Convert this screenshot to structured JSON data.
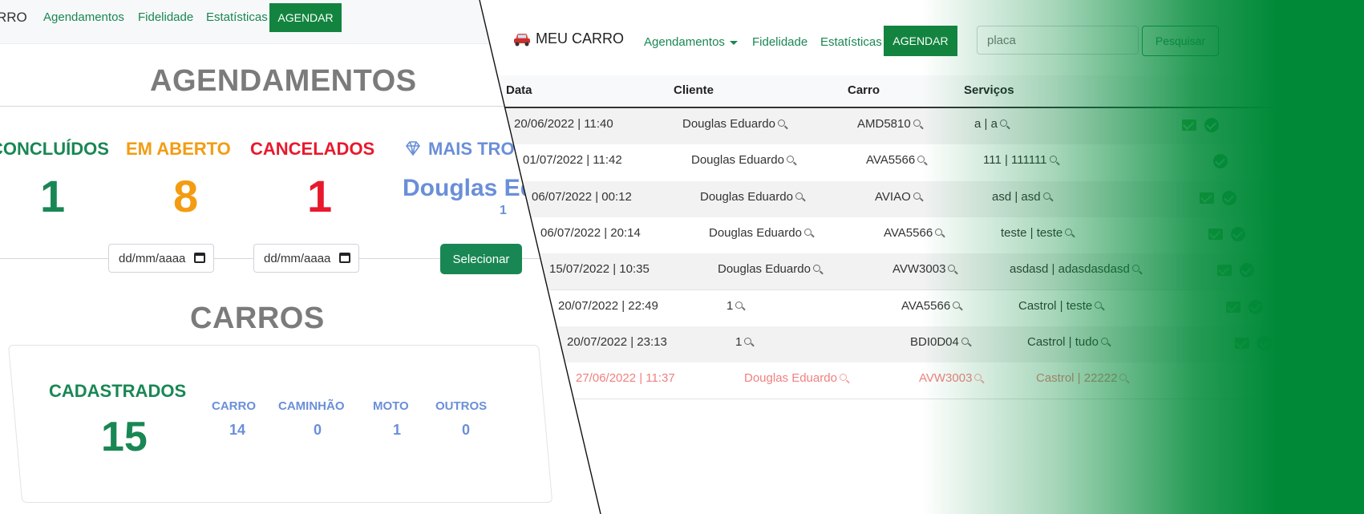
{
  "left_panel": {
    "nav": {
      "brand_fragment": "RRO",
      "links": [
        "Agendamentos",
        "Fidelidade",
        "Estatísticas"
      ],
      "cta": "AGENDAR"
    },
    "title": "AGENDAMENTOS",
    "stats": [
      {
        "label": "CONCLUÍDOS",
        "value": "1",
        "color": "#198754"
      },
      {
        "label": "EM ABERTO",
        "value": "8",
        "color": "#f39c12"
      },
      {
        "label": "CANCELADOS",
        "value": "1",
        "color": "#e8192c"
      },
      {
        "label": "MAIS TROCAS",
        "value": "Douglas Eduardo",
        "sub": "1",
        "color": "#6a8fd8",
        "icon": "diamond-icon"
      }
    ],
    "date_from_placeholder": "dd/mm/aaaa",
    "date_to_placeholder": "dd/mm/aaaa",
    "select_button": "Selecionar",
    "cars_title": "CARROS",
    "cars": {
      "registered_label": "CADASTRADOS",
      "registered_value": "15",
      "categories": [
        {
          "label": "CARRO",
          "value": "14"
        },
        {
          "label": "CAMINHÃO",
          "value": "0"
        },
        {
          "label": "MOTO",
          "value": "1"
        },
        {
          "label": "OUTROS",
          "value": "0"
        }
      ]
    }
  },
  "right_panel": {
    "brand": "MEU CARRO",
    "nav_links": [
      "Agendamentos",
      "Fidelidade",
      "Estatísticas"
    ],
    "cta": "AGENDAR",
    "search_placeholder": "placa",
    "search_button": "Pesquisar",
    "columns": [
      "Data",
      "Cliente",
      "Carro",
      "Serviços"
    ],
    "rows": [
      {
        "date": "20/06/2022 | 11:40",
        "client": "Douglas Eduardo",
        "car": "AMD5810",
        "service": "a | a",
        "mail": true,
        "done": true,
        "cancelled": false
      },
      {
        "date": "01/07/2022 | 11:42",
        "client": "Douglas Eduardo",
        "car": "AVA5566",
        "service": "111 | 111111",
        "mail": false,
        "done": true,
        "cancelled": false
      },
      {
        "date": "06/07/2022 | 00:12",
        "client": "Douglas Eduardo",
        "car": "AVIAO",
        "service": "asd | asd",
        "mail": true,
        "done": true,
        "cancelled": false
      },
      {
        "date": "06/07/2022 | 20:14",
        "client": "Douglas Eduardo",
        "car": "AVA5566",
        "service": "teste | teste",
        "mail": true,
        "done": true,
        "cancelled": false
      },
      {
        "date": "15/07/2022 | 10:35",
        "client": "Douglas Eduardo",
        "car": "AVW3003",
        "service": "asdasd | adasdasdasd",
        "mail": true,
        "done": true,
        "cancelled": false
      },
      {
        "date": "20/07/2022 | 22:49",
        "client": "1",
        "car": "AVA5566",
        "service": "Castrol | teste",
        "mail": true,
        "done": true,
        "cancelled": false
      },
      {
        "date": "20/07/2022 | 23:13",
        "client": "1",
        "car": "BDI0D04",
        "service": "Castrol | tudo",
        "mail": true,
        "done": true,
        "cancelled": false
      },
      {
        "date": "27/06/2022 | 11:37",
        "client": "Douglas Eduardo",
        "car": "AVW3003",
        "service": "Castrol | 22222",
        "mail": false,
        "done": false,
        "cancelled": true
      }
    ]
  },
  "colors": {
    "brand_green": "#198754",
    "gradient_green": "#008a38",
    "cancelled_red": "#f08080"
  }
}
